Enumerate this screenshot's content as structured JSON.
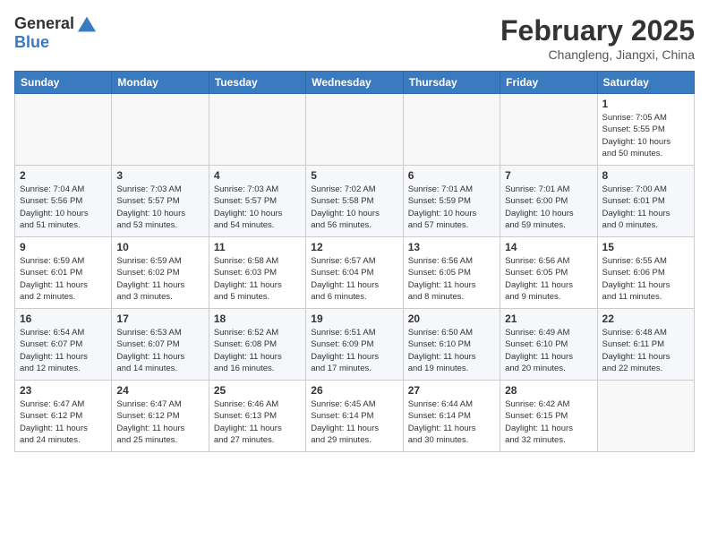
{
  "header": {
    "logo_general": "General",
    "logo_blue": "Blue",
    "month_title": "February 2025",
    "subtitle": "Changleng, Jiangxi, China"
  },
  "weekdays": [
    "Sunday",
    "Monday",
    "Tuesday",
    "Wednesday",
    "Thursday",
    "Friday",
    "Saturday"
  ],
  "weeks": [
    [
      {
        "day": "",
        "info": ""
      },
      {
        "day": "",
        "info": ""
      },
      {
        "day": "",
        "info": ""
      },
      {
        "day": "",
        "info": ""
      },
      {
        "day": "",
        "info": ""
      },
      {
        "day": "",
        "info": ""
      },
      {
        "day": "1",
        "info": "Sunrise: 7:05 AM\nSunset: 5:55 PM\nDaylight: 10 hours\nand 50 minutes."
      }
    ],
    [
      {
        "day": "2",
        "info": "Sunrise: 7:04 AM\nSunset: 5:56 PM\nDaylight: 10 hours\nand 51 minutes."
      },
      {
        "day": "3",
        "info": "Sunrise: 7:03 AM\nSunset: 5:57 PM\nDaylight: 10 hours\nand 53 minutes."
      },
      {
        "day": "4",
        "info": "Sunrise: 7:03 AM\nSunset: 5:57 PM\nDaylight: 10 hours\nand 54 minutes."
      },
      {
        "day": "5",
        "info": "Sunrise: 7:02 AM\nSunset: 5:58 PM\nDaylight: 10 hours\nand 56 minutes."
      },
      {
        "day": "6",
        "info": "Sunrise: 7:01 AM\nSunset: 5:59 PM\nDaylight: 10 hours\nand 57 minutes."
      },
      {
        "day": "7",
        "info": "Sunrise: 7:01 AM\nSunset: 6:00 PM\nDaylight: 10 hours\nand 59 minutes."
      },
      {
        "day": "8",
        "info": "Sunrise: 7:00 AM\nSunset: 6:01 PM\nDaylight: 11 hours\nand 0 minutes."
      }
    ],
    [
      {
        "day": "9",
        "info": "Sunrise: 6:59 AM\nSunset: 6:01 PM\nDaylight: 11 hours\nand 2 minutes."
      },
      {
        "day": "10",
        "info": "Sunrise: 6:59 AM\nSunset: 6:02 PM\nDaylight: 11 hours\nand 3 minutes."
      },
      {
        "day": "11",
        "info": "Sunrise: 6:58 AM\nSunset: 6:03 PM\nDaylight: 11 hours\nand 5 minutes."
      },
      {
        "day": "12",
        "info": "Sunrise: 6:57 AM\nSunset: 6:04 PM\nDaylight: 11 hours\nand 6 minutes."
      },
      {
        "day": "13",
        "info": "Sunrise: 6:56 AM\nSunset: 6:05 PM\nDaylight: 11 hours\nand 8 minutes."
      },
      {
        "day": "14",
        "info": "Sunrise: 6:56 AM\nSunset: 6:05 PM\nDaylight: 11 hours\nand 9 minutes."
      },
      {
        "day": "15",
        "info": "Sunrise: 6:55 AM\nSunset: 6:06 PM\nDaylight: 11 hours\nand 11 minutes."
      }
    ],
    [
      {
        "day": "16",
        "info": "Sunrise: 6:54 AM\nSunset: 6:07 PM\nDaylight: 11 hours\nand 12 minutes."
      },
      {
        "day": "17",
        "info": "Sunrise: 6:53 AM\nSunset: 6:07 PM\nDaylight: 11 hours\nand 14 minutes."
      },
      {
        "day": "18",
        "info": "Sunrise: 6:52 AM\nSunset: 6:08 PM\nDaylight: 11 hours\nand 16 minutes."
      },
      {
        "day": "19",
        "info": "Sunrise: 6:51 AM\nSunset: 6:09 PM\nDaylight: 11 hours\nand 17 minutes."
      },
      {
        "day": "20",
        "info": "Sunrise: 6:50 AM\nSunset: 6:10 PM\nDaylight: 11 hours\nand 19 minutes."
      },
      {
        "day": "21",
        "info": "Sunrise: 6:49 AM\nSunset: 6:10 PM\nDaylight: 11 hours\nand 20 minutes."
      },
      {
        "day": "22",
        "info": "Sunrise: 6:48 AM\nSunset: 6:11 PM\nDaylight: 11 hours\nand 22 minutes."
      }
    ],
    [
      {
        "day": "23",
        "info": "Sunrise: 6:47 AM\nSunset: 6:12 PM\nDaylight: 11 hours\nand 24 minutes."
      },
      {
        "day": "24",
        "info": "Sunrise: 6:47 AM\nSunset: 6:12 PM\nDaylight: 11 hours\nand 25 minutes."
      },
      {
        "day": "25",
        "info": "Sunrise: 6:46 AM\nSunset: 6:13 PM\nDaylight: 11 hours\nand 27 minutes."
      },
      {
        "day": "26",
        "info": "Sunrise: 6:45 AM\nSunset: 6:14 PM\nDaylight: 11 hours\nand 29 minutes."
      },
      {
        "day": "27",
        "info": "Sunrise: 6:44 AM\nSunset: 6:14 PM\nDaylight: 11 hours\nand 30 minutes."
      },
      {
        "day": "28",
        "info": "Sunrise: 6:42 AM\nSunset: 6:15 PM\nDaylight: 11 hours\nand 32 minutes."
      },
      {
        "day": "",
        "info": ""
      }
    ]
  ]
}
